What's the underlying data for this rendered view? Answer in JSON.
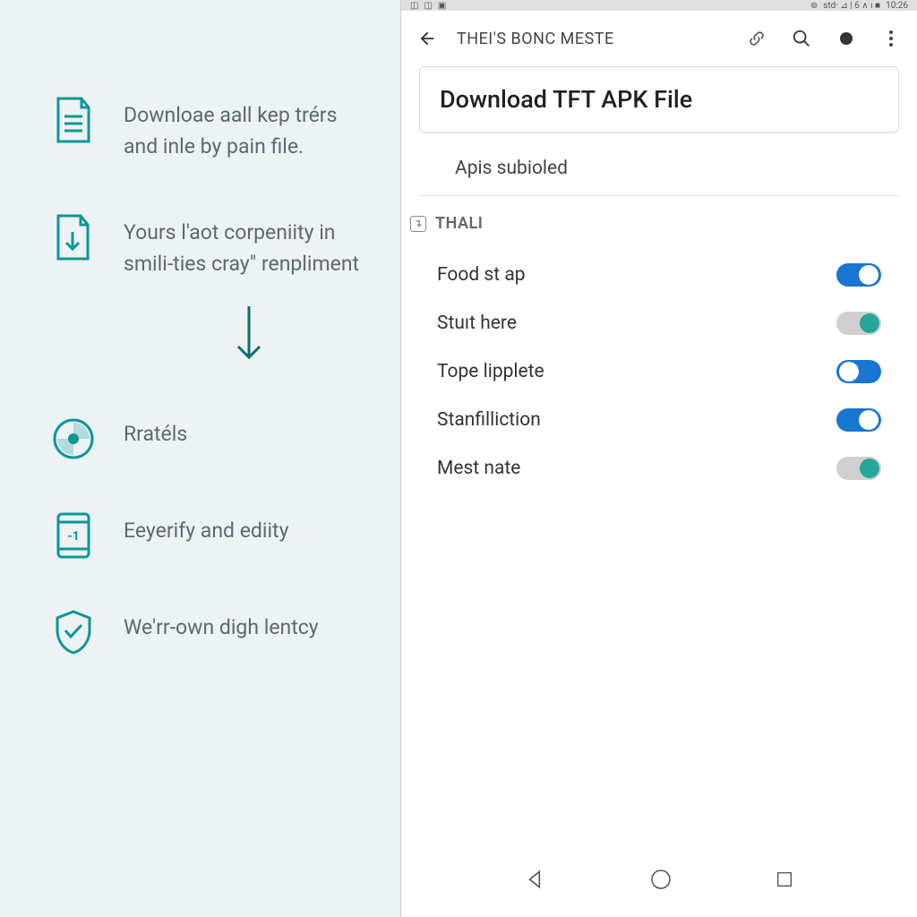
{
  "left": {
    "steps": [
      {
        "text": "Downloae aall kep trérs and inle by pain file."
      },
      {
        "text": "Yours l'aot corpeniity in smili-ties cray\" renpliment"
      },
      {
        "text": "Rratéls"
      },
      {
        "text": "Eeyerify and ediity"
      },
      {
        "text": "We'rr-own digh lentcy"
      }
    ]
  },
  "right": {
    "status": {
      "time": "10:26",
      "signal": "std· ⊿ | 6 ∧ ı ■"
    },
    "appbar": {
      "title": "THEI'S BONC MESTE"
    },
    "card": {
      "title": "Download TFT APK File"
    },
    "subtitle": "Apis subioled",
    "section": {
      "header": "THALI",
      "icon": "↴",
      "items": [
        {
          "label": "Food st ap",
          "toggle": "blue-on"
        },
        {
          "label": "Stuıt here",
          "toggle": "teal-on"
        },
        {
          "label": "Tope lipplete",
          "toggle": "blue-off"
        },
        {
          "label": "Stanfilliction",
          "toggle": "blue-on"
        },
        {
          "label": "Mest nate",
          "toggle": "teal-on"
        }
      ]
    }
  },
  "colors": {
    "teal": "#0d9896",
    "blue": "#1976d2",
    "tealToggle": "#26a69a"
  }
}
